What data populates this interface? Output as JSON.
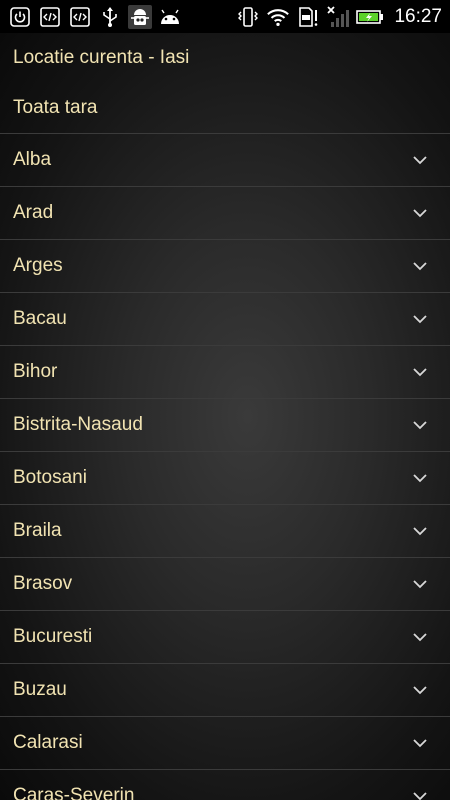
{
  "status_bar": {
    "time": "16:27",
    "left_icons": [
      "power-icon",
      "code-icon",
      "code-icon",
      "usb-icon",
      "android-bug-icon",
      "android-icon"
    ],
    "right_icons": [
      "vibrate-icon",
      "wifi-icon",
      "sd-alert-icon",
      "no-signal-icon",
      "battery-charging-icon"
    ],
    "battery_color": "#5cd12a"
  },
  "header": {
    "current_location": "Locatie curenta - Iasi",
    "whole_country": "Toata tara"
  },
  "counties": [
    "Alba",
    "Arad",
    "Arges",
    "Bacau",
    "Bihor",
    "Bistrita-Nasaud",
    "Botosani",
    "Braila",
    "Brasov",
    "Bucuresti",
    "Buzau",
    "Calarasi",
    "Caras-Severin"
  ],
  "colors": {
    "text": "#f1e3b2",
    "divider": "#3b3b3b",
    "chevron": "#d8d8d8"
  }
}
